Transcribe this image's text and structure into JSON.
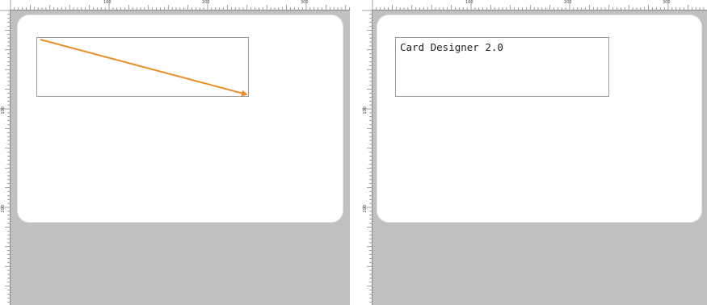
{
  "colors": {
    "workspace_bg": "#c0c0c0",
    "card_bg": "#ffffff",
    "arrow": "#e8902a",
    "object_border": "#9a9a9a"
  },
  "left_panel": {
    "ruler_top_labels": [
      "100",
      "200",
      "300"
    ],
    "ruler_left_labels": [
      "100",
      "200"
    ],
    "line_object": {
      "type": "arrow",
      "direction": "top-left to bottom-right"
    }
  },
  "right_panel": {
    "ruler_top_labels": [
      "100",
      "200",
      "300"
    ],
    "ruler_left_labels": [
      "100",
      "200"
    ],
    "text_object": {
      "text": "Card Designer 2.0"
    }
  }
}
